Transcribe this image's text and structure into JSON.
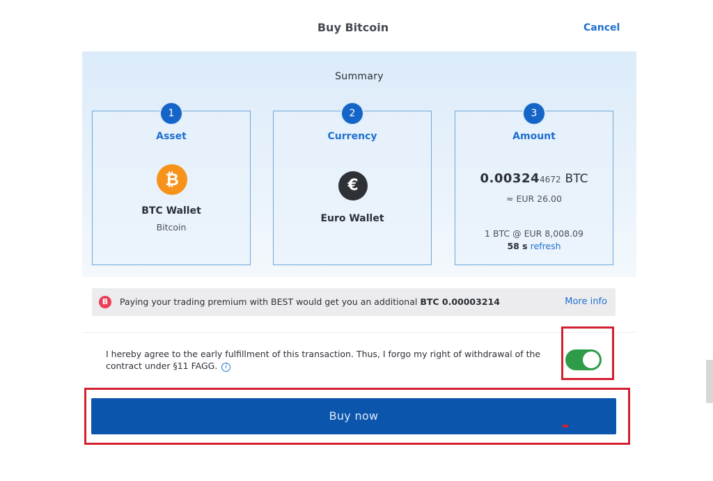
{
  "header": {
    "title": "Buy Bitcoin",
    "cancel_label": "Cancel"
  },
  "summary": {
    "title": "Summary",
    "cards": [
      {
        "number": "1",
        "heading": "Asset",
        "icon": "bitcoin-icon",
        "icon_glyph": "₿",
        "primary": "BTC Wallet",
        "secondary": "Bitcoin"
      },
      {
        "number": "2",
        "heading": "Currency",
        "icon": "euro-icon",
        "icon_glyph": "€",
        "primary": "Euro Wallet"
      },
      {
        "number": "3",
        "heading": "Amount",
        "amount_main": "0.00324",
        "amount_tail": "4672",
        "amount_unit": "BTC",
        "eur_approx": "≈ EUR 26.00",
        "rate": "1 BTC @ EUR 8,008.09",
        "timer": "58 s",
        "refresh_label": "refresh"
      }
    ]
  },
  "premium": {
    "icon": "best-token-icon",
    "icon_glyph": "B",
    "text": "Paying your trading premium with BEST would get you an additional",
    "bonus": "BTC 0.00003214",
    "more_info_label": "More info"
  },
  "agreement": {
    "text": "I hereby agree to the early fulfillment of this transaction. Thus, I forgo my right of withdrawal of the contract under §11 FAGG.",
    "info_glyph": "i",
    "toggle_on": true
  },
  "buy_button_label": "Buy now",
  "colors": {
    "accent": "#1f6fcf",
    "button": "#0b55ad",
    "toggle_on": "#2e9b48",
    "highlight": "#d2202f",
    "bitcoin": "#f7931a"
  }
}
